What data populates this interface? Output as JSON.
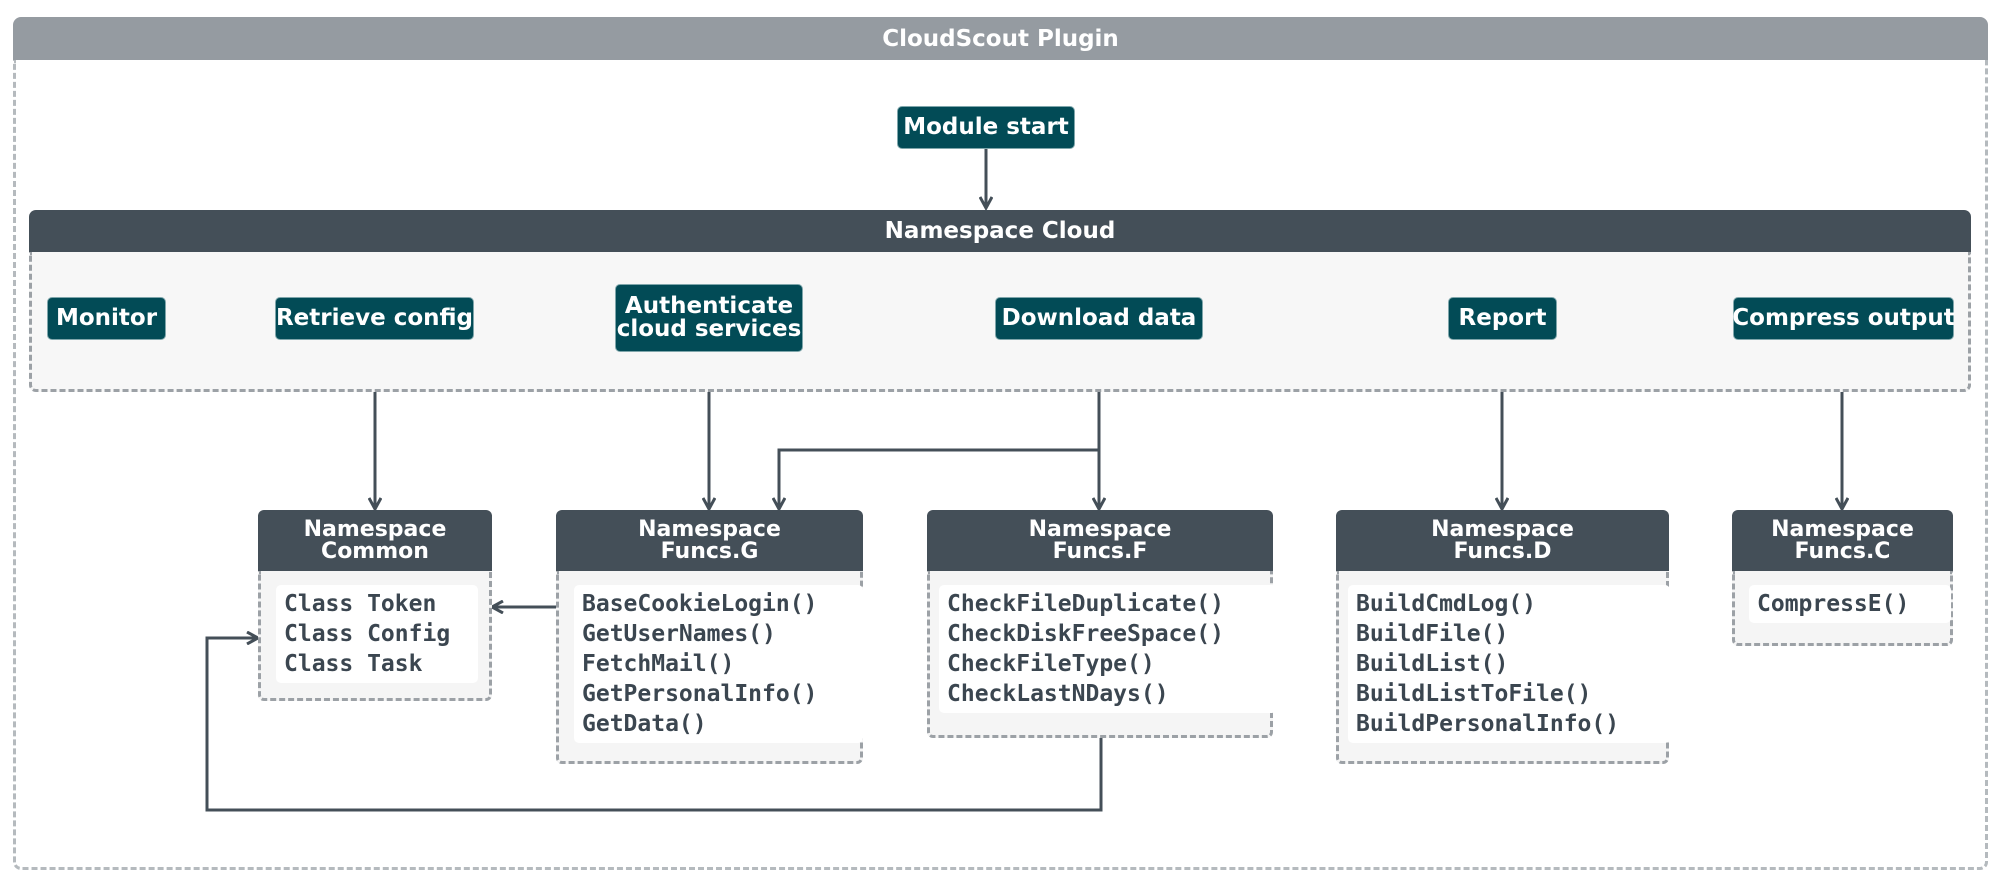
{
  "plugin": {
    "title": "CloudScout Plugin"
  },
  "start": {
    "label": "Module start"
  },
  "cloud": {
    "title": "Namespace Cloud",
    "steps": [
      {
        "label": "Monitor"
      },
      {
        "label": "Retrieve config"
      },
      {
        "label": "Authenticate cloud services",
        "line1": "Authenticate",
        "line2": "cloud services"
      },
      {
        "label": "Download data"
      },
      {
        "label": "Report"
      },
      {
        "label": "Compress output"
      }
    ]
  },
  "namespaces": [
    {
      "line1": "Namespace",
      "line2": "Common",
      "items": [
        "Class Token",
        "Class Config",
        "Class Task"
      ]
    },
    {
      "line1": "Namespace",
      "line2": "Funcs.G",
      "items": [
        "BaseCookieLogin()",
        "GetUserNames()",
        "FetchMail()",
        "GetPersonalInfo()",
        "GetData()"
      ]
    },
    {
      "line1": "Namespace",
      "line2": "Funcs.F",
      "items": [
        "CheckFileDuplicate()",
        "CheckDiskFreeSpace()",
        "CheckFileType()",
        "CheckLastNDays()"
      ]
    },
    {
      "line1": "Namespace",
      "line2": "Funcs.D",
      "items": [
        "BuildCmdLog()",
        "BuildFile()",
        "BuildList()",
        "BuildListToFile()",
        "BuildPersonalInfo()"
      ]
    },
    {
      "line1": "Namespace",
      "line2": "Funcs.C",
      "items": [
        "CompressE()"
      ]
    }
  ],
  "colors": {
    "node": "#024b56",
    "header": "#444f58",
    "frame_header": "#959ba1",
    "line": "#444f58"
  }
}
